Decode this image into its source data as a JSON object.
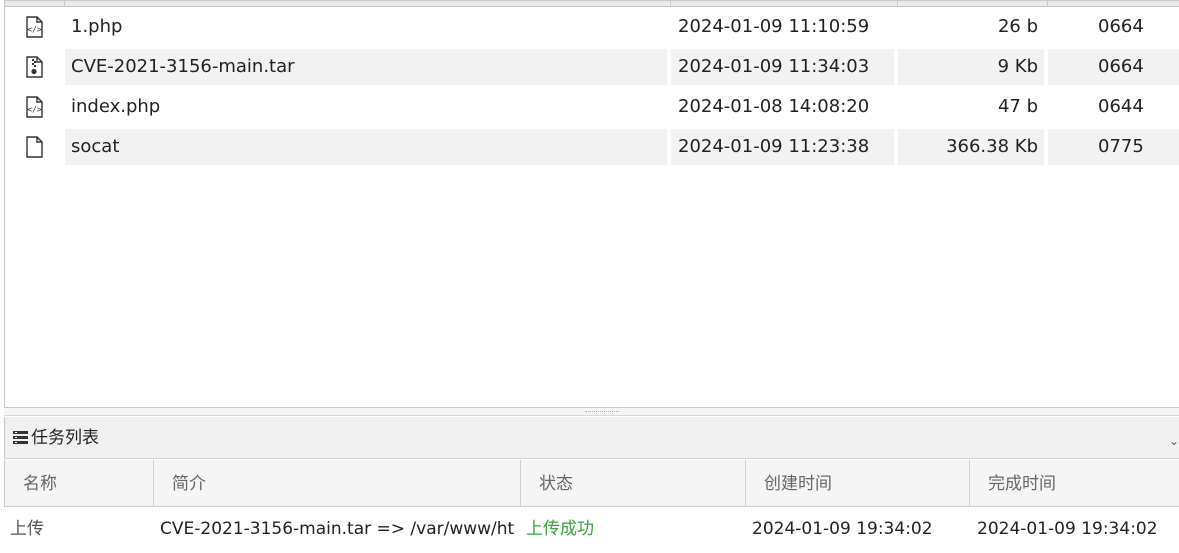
{
  "files": [
    {
      "icon": "php-file-icon",
      "name": "1.php",
      "modified": "2024-01-09 11:10:59",
      "size": "26 b",
      "perms": "0664"
    },
    {
      "icon": "archive-file-icon",
      "name": "CVE-2021-3156-main.tar",
      "modified": "2024-01-09 11:34:03",
      "size": "9 Kb",
      "perms": "0664"
    },
    {
      "icon": "php-file-icon",
      "name": "index.php",
      "modified": "2024-01-08 14:08:20",
      "size": "47 b",
      "perms": "0644"
    },
    {
      "icon": "blank-file-icon",
      "name": "socat",
      "modified": "2024-01-09 11:23:38",
      "size": "366.38 Kb",
      "perms": "0775"
    }
  ],
  "task_panel": {
    "title": "任务列表",
    "columns": [
      "名称",
      "简介",
      "状态",
      "创建时间",
      "完成时间"
    ],
    "rows": [
      {
        "name": "上传",
        "desc": "CVE-2021-3156-main.tar => /var/www/ht",
        "status": "上传成功",
        "created": "2024-01-09 19:34:02",
        "finished": "2024-01-09 19:34:02"
      }
    ]
  },
  "colors": {
    "status_success": "#3aa13a",
    "stripe": "#f2f2f2",
    "header_bg": "#f0f0f0"
  }
}
